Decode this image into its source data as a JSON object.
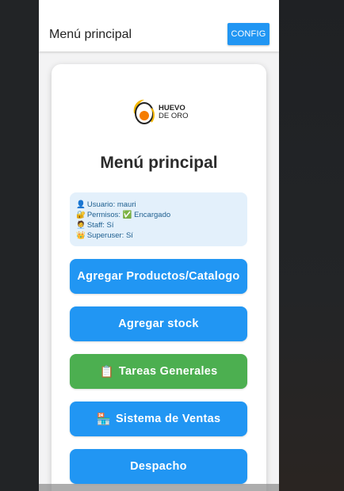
{
  "appbar": {
    "title": "Menú principal",
    "config_label": "CONFIG"
  },
  "logo": {
    "line1": "HUEVO",
    "line2": "DE ORO"
  },
  "card": {
    "title": "Menú principal"
  },
  "user_info": [
    {
      "icon": "👤",
      "text": "Usuario: mauri"
    },
    {
      "icon": "🔐",
      "text": "Permisos: ✅ Encargado"
    },
    {
      "icon": "🧑‍💼",
      "text": "Staff: Sí"
    },
    {
      "icon": "👑",
      "text": "Superuser: Sí"
    }
  ],
  "menu": [
    {
      "label": "Agregar Productos/Catalogo",
      "icon": "",
      "color": "#2196f3"
    },
    {
      "label": "Agregar stock",
      "icon": "",
      "color": "#2196f3"
    },
    {
      "label": "Tareas Generales",
      "icon": "📋",
      "color": "#4caf50"
    },
    {
      "label": "Sistema de Ventas",
      "icon": "🏪",
      "color": "#2196f3"
    },
    {
      "label": "Despacho",
      "icon": "",
      "color": "#2196f3"
    }
  ],
  "colors": {
    "primary": "#2196f3",
    "success": "#4caf50",
    "info_bg": "#e3f0fb"
  }
}
